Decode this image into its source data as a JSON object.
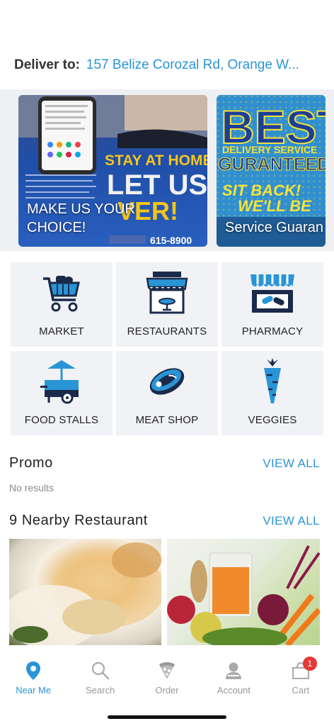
{
  "deliver": {
    "label": "Deliver to:",
    "address": "157 Belize Corozal Rd, Orange W..."
  },
  "banners": [
    {
      "caption": "MAKE US YOUR\nCHOICE!"
    },
    {
      "caption": "Service Guaran"
    }
  ],
  "categories": [
    {
      "label": "MARKET",
      "icon": "shopping-cart-icon"
    },
    {
      "label": "RESTAURANTS",
      "icon": "restaurant-storefront-icon"
    },
    {
      "label": "PHARMACY",
      "icon": "pharmacy-storefront-icon"
    },
    {
      "label": "FOOD STALLS",
      "icon": "food-stall-cart-icon"
    },
    {
      "label": "MEAT SHOP",
      "icon": "steak-icon"
    },
    {
      "label": "VEGGIES",
      "icon": "carrot-icon"
    }
  ],
  "promo": {
    "title": "Promo",
    "view_all": "VIEW ALL",
    "empty_text": "No results"
  },
  "nearby": {
    "title": "9 Nearby Restaurant",
    "view_all": "VIEW ALL"
  },
  "tabs": [
    {
      "label": "Near Me",
      "icon": "location-pin-icon",
      "active": true
    },
    {
      "label": "Search",
      "icon": "search-icon",
      "active": false
    },
    {
      "label": "Order",
      "icon": "pizza-slice-icon",
      "active": false
    },
    {
      "label": "Account",
      "icon": "user-icon",
      "active": false
    },
    {
      "label": "Cart",
      "icon": "cart-bag-icon",
      "active": false,
      "badge": "1"
    }
  ],
  "colors": {
    "accent": "#2a95d6",
    "badge": "#e53935",
    "icon_navy": "#1b2a4a",
    "icon_blue": "#2a95d6"
  }
}
